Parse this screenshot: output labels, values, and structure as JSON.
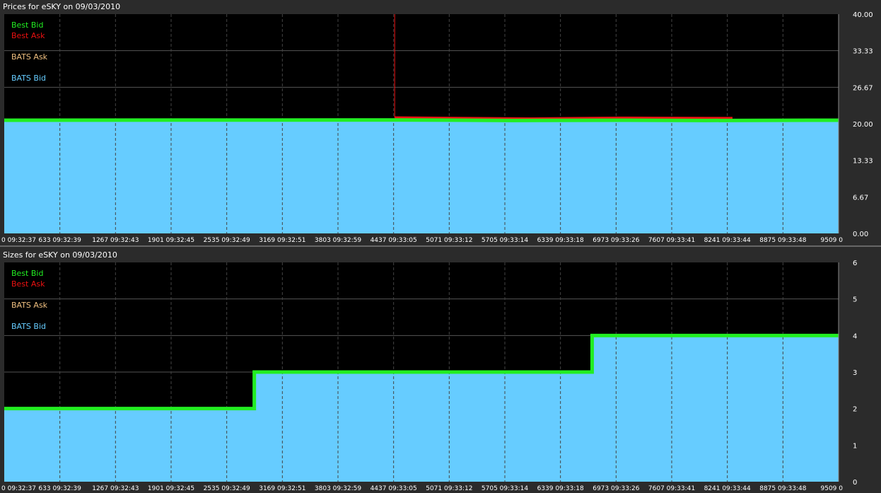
{
  "chart_data": [
    {
      "type": "area",
      "title": "Prices for  eSKY  on  09/03/2010",
      "legend": [
        "Best Bid",
        "Best Ask",
        "BATS Ask",
        "BATS Bid"
      ],
      "legend_placement": "top-left",
      "ylim": [
        0,
        40
      ],
      "y_ticks": [
        "40.00",
        "33.33",
        "26.67",
        "20.00",
        "13.33",
        "6.67",
        "0.00"
      ],
      "x_ticks": [
        "0 09:32:37",
        "633 09:32:39",
        "1267 09:32:43",
        "1901 09:32:45",
        "2535 09:32:49",
        "3169 09:32:51",
        "3803 09:32:59",
        "4437 09:33:05",
        "5071 09:33:12",
        "5705 09:33:14",
        "6339 09:33:18",
        "6973 09:33:26",
        "7607 09:33:41",
        "8241 09:33:44",
        "8875 09:33:48",
        "9509 0"
      ],
      "xlim": [
        0,
        9509
      ],
      "grid": true,
      "series": [
        {
          "name": "BATS Bid",
          "x": [
            0,
            9509
          ],
          "values": [
            20.5,
            20.5
          ]
        },
        {
          "name": "Best Bid",
          "x": [
            0,
            4450,
            5800,
            7000,
            8000,
            9509
          ],
          "values": [
            20.65,
            20.7,
            20.6,
            20.65,
            20.6,
            20.65
          ]
        },
        {
          "name": "Best Ask",
          "x": [
            4450,
            5200,
            6000,
            7000,
            8000,
            8300
          ],
          "values": [
            21.1,
            21.0,
            20.9,
            21.05,
            21.0,
            21.0
          ]
        }
      ]
    },
    {
      "type": "area",
      "title": "Sizes for  eSKY  on  09/03/2010",
      "legend": [
        "Best Bid",
        "Best Ask",
        "BATS Ask",
        "BATS Bid"
      ],
      "legend_placement": "top-left",
      "ylim": [
        0,
        6
      ],
      "y_ticks": [
        "6",
        "5",
        "4",
        "3",
        "2",
        "1",
        "0"
      ],
      "x_ticks": [
        "0 09:32:37",
        "633 09:32:39",
        "1267 09:32:43",
        "1901 09:32:45",
        "2535 09:32:49",
        "3169 09:32:51",
        "3803 09:32:59",
        "4437 09:33:05",
        "5071 09:33:12",
        "5705 09:33:14",
        "6339 09:33:18",
        "6973 09:33:26",
        "7607 09:33:41",
        "8241 09:33:44",
        "8875 09:33:48",
        "9509 0"
      ],
      "xlim": [
        0,
        9509
      ],
      "grid": true,
      "series": [
        {
          "name": "BATS Bid",
          "x": [
            0,
            2850,
            2850,
            6700,
            6700,
            9509
          ],
          "values": [
            2,
            2,
            3,
            3,
            4,
            4
          ]
        },
        {
          "name": "Best Bid",
          "x": [
            0,
            2850,
            2850,
            6700,
            6700,
            9509
          ],
          "values": [
            2,
            2,
            3,
            3,
            4,
            4
          ]
        }
      ]
    }
  ],
  "colors": {
    "best_bid": "#22ee22",
    "best_ask": "#ee1111",
    "bats_ask": "#f0c080",
    "bats_bid": "#66ccff"
  }
}
